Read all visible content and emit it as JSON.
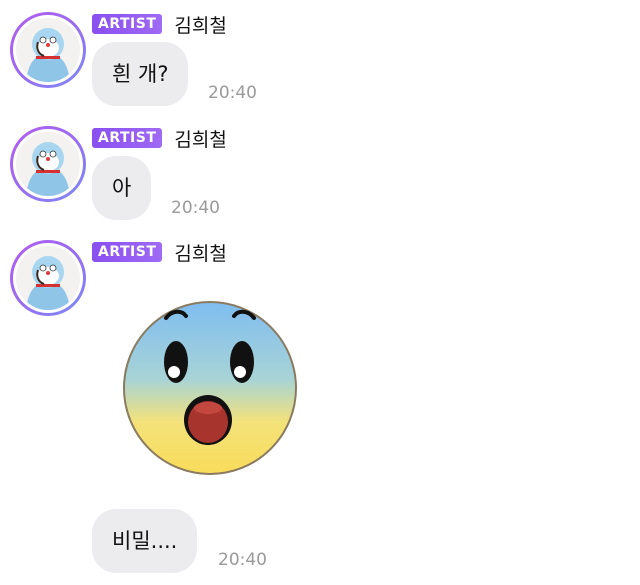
{
  "messages": [
    {
      "badge": "ARTIST",
      "author": "김희철",
      "text": "흰 개?",
      "time": "20:40"
    },
    {
      "badge": "ARTIST",
      "author": "김희철",
      "text": "아",
      "time": "20:40"
    },
    {
      "badge": "ARTIST",
      "author": "김희철",
      "sticker": "shocked-face-emoji",
      "text": "비밀....",
      "time": "20:40"
    }
  ],
  "colors": {
    "badge": "#8a4ff0",
    "bubble": "#ececef",
    "timestamp": "#9a9a9a",
    "avatar_ring": "#b35cf0"
  }
}
